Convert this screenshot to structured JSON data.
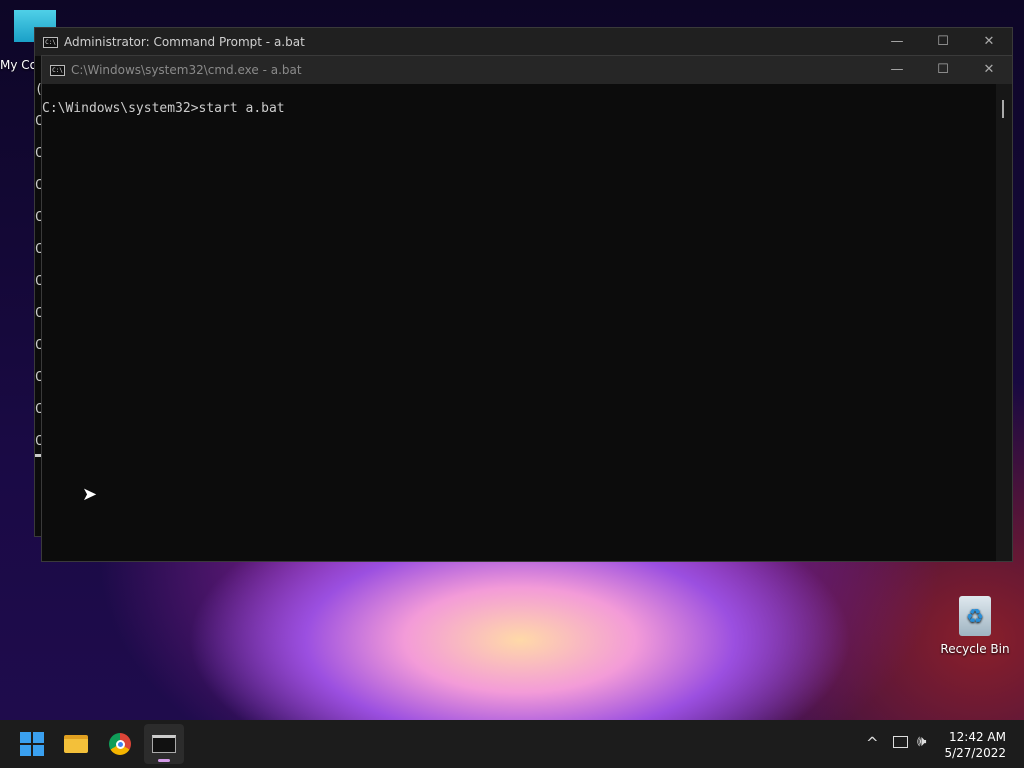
{
  "desktop": {
    "icons": [
      {
        "label": "My Computer"
      },
      {
        "label": "Recycle Bin"
      }
    ]
  },
  "back_window": {
    "title": "Administrator: Command Prompt - a.bat",
    "visible_lines": [
      "(",
      "C",
      "C",
      "C",
      "C",
      "C",
      "C",
      "C",
      "C",
      "C",
      "C",
      "C"
    ]
  },
  "front_window": {
    "title": "C:\\Windows\\system32\\cmd.exe - a.bat",
    "console_text": "C:\\Windows\\system32>start a.bat"
  },
  "window_controls": {
    "minimize": "—",
    "maximize": "☐",
    "close": "✕"
  },
  "taskbar": {
    "clock_time": "12:42 AM",
    "clock_date": "5/27/2022",
    "tray_chevron": "^"
  }
}
